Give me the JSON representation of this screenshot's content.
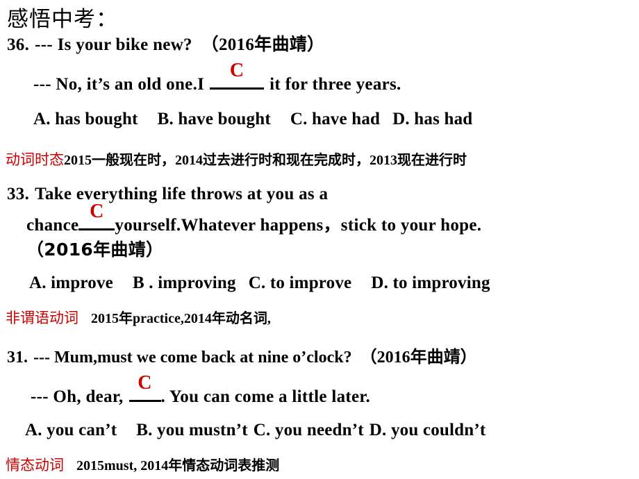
{
  "slide": {
    "title": "感悟中考：",
    "accent_color": "#CC0000",
    "text_color": "#000000",
    "background_color": "#FFFFFF"
  },
  "questions": [
    {
      "number": "36.",
      "prompt_line": "--- Is your bike new?　（2016年曲靖）",
      "answer_line_pre": "--- No, it’s an old one.I",
      "answer_letter": "C",
      "answer_line_post": "it for three years.",
      "options": [
        "A. has bought",
        "B. have bought",
        "C. have had",
        "D. has had"
      ],
      "explanation_tag": "动词时态",
      "explanation_body": "2015一般现在时，2014过去进行时和现在完成时，2013现在进行时"
    },
    {
      "number": "33.",
      "prompt_line_1": "Take everything life throws  at you as a",
      "prompt_line_2_pre": "chance",
      "answer_letter": "C",
      "prompt_line_2_post": "yourself.Whatever happens，stick to your hope.",
      "prompt_line_3": "（2016年曲靖）",
      "options": [
        "A. improve",
        "B . improving",
        "C. to improve",
        "D. to improving"
      ],
      "explanation_tag": "非谓语动词",
      "explanation_body": "2015年practice,2014年动名词,"
    },
    {
      "number": "31.",
      "prompt_line": "--- Mum,must we come back at nine o’clock?　（2016年曲靖）",
      "answer_line_pre": "--- Oh, dear,",
      "answer_letter": "C",
      "answer_line_post": ". You can come a little later.",
      "options": [
        "A. you can’t",
        "B. you mustn’t",
        "C. you needn’t",
        "D. you couldn’t"
      ],
      "explanation_tag": "情态动词",
      "explanation_body": "2015must, 2014年情态动词表推测"
    }
  ]
}
